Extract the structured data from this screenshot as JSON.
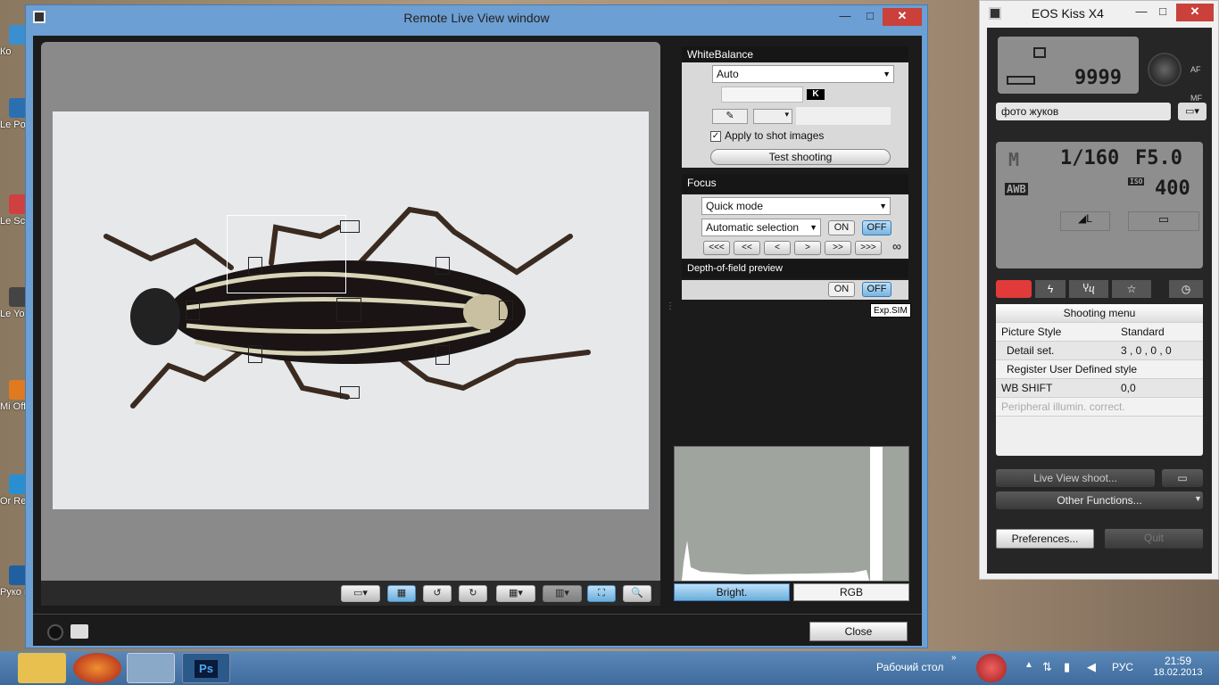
{
  "desktop": {
    "icons": [
      {
        "label": "Ко"
      },
      {
        "label": "Le Powe"
      },
      {
        "label": "Le Sc"
      },
      {
        "label": "Le Yo"
      },
      {
        "label": "Mi Offi"
      },
      {
        "label": "Or Re"
      },
      {
        "label": "Руко поль"
      }
    ]
  },
  "remote": {
    "title": "Remote Live View window",
    "minimize": "—",
    "maximize": "□",
    "close": "✕",
    "white_balance": {
      "header": "WhiteBalance",
      "mode": "Auto",
      "k_label": "K",
      "apply_label": "Apply to shot images",
      "apply_checked": true,
      "test_shooting": "Test shooting"
    },
    "focus": {
      "header": "Focus",
      "mode": "Quick mode",
      "af_point": "Automatic selection",
      "on": "ON",
      "off": "OFF",
      "drive_buttons": [
        "<<<",
        "<<",
        "<",
        ">",
        ">>",
        ">>>"
      ],
      "infinity": "∞"
    },
    "dof": {
      "header": "Depth-of-field preview",
      "on": "ON",
      "off": "OFF"
    },
    "exp_sim": "Exp.SIM",
    "histogram": {
      "bright": "Bright.",
      "rgb": "RGB"
    },
    "close_button": "Close"
  },
  "eos": {
    "title": "EOS Kiss X4",
    "minimize": "—",
    "maximize": "□",
    "close": "✕",
    "shots_remaining": "9999",
    "af": "AF",
    "mf": "MF",
    "folder": "фото жуков",
    "mode": "M",
    "shutter": "1/160",
    "aperture": "F5.0",
    "wb": "AWB",
    "iso_label": "ISO",
    "iso": "400",
    "menu_title": "Shooting menu",
    "menu_rows": [
      {
        "label": "Picture Style",
        "value": "Standard"
      },
      {
        "label": "Detail set.",
        "value": "3 , 0 , 0 , 0"
      },
      {
        "label": "Register User Defined style",
        "value": ""
      },
      {
        "label": "WB SHIFT",
        "value": "0,0"
      },
      {
        "label": "Peripheral illumin. correct.",
        "value": ""
      }
    ],
    "live_view_shoot": "Live View shoot...",
    "other_functions": "Other Functions...",
    "preferences": "Preferences...",
    "quit": "Quit"
  },
  "taskbar": {
    "desktop_label": "Рабочий стол",
    "lang": "РУС",
    "time": "21:59",
    "date": "18.02.2013",
    "ps": "Ps"
  }
}
